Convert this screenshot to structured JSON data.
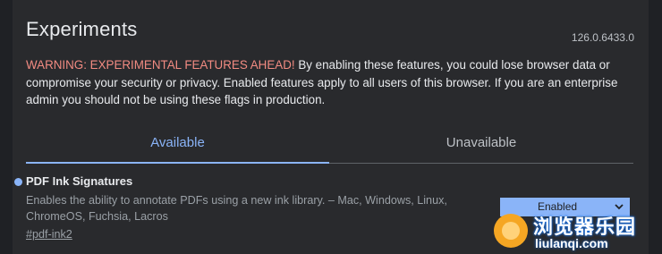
{
  "header": {
    "title": "Experiments",
    "version": "126.0.6433.0"
  },
  "warning": {
    "headline": "WARNING: EXPERIMENTAL FEATURES AHEAD!",
    "body": " By enabling these features, you could lose browser data or compromise your security or privacy. Enabled features apply to all users of this browser. If you are an enterprise admin you should not be using these flags in production."
  },
  "tabs": [
    {
      "label": "Available",
      "active": true
    },
    {
      "label": "Unavailable",
      "active": false
    }
  ],
  "flags": [
    {
      "name": "PDF Ink Signatures",
      "description": "Enables the ability to annotate PDFs using a new ink library. – Mac, Windows, Linux, ChromeOS, Fuchsia, Lacros",
      "anchor": "#pdf-ink2",
      "state": "Enabled"
    }
  ],
  "watermark": {
    "text_cn": "浏览器乐园",
    "text_py": "liulanqi.com"
  },
  "colors": {
    "accent": "#8ab4f8",
    "warning": "#f28b82",
    "background": "#292a2d"
  }
}
